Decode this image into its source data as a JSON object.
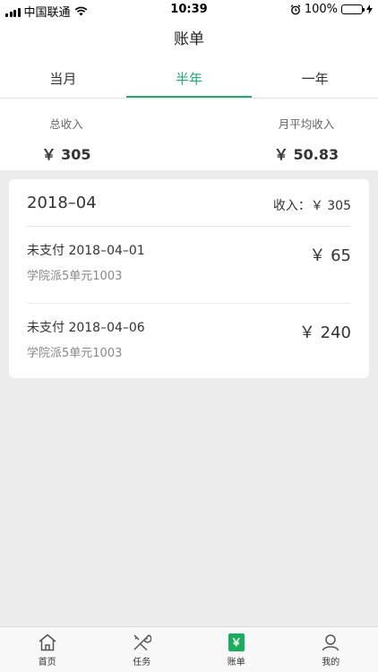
{
  "status_bar": {
    "carrier": "中国联通",
    "time": "10:39",
    "battery": "100%",
    "battery_level": 1.0
  },
  "nav": {
    "title": "账单"
  },
  "tabs": [
    {
      "label": "当月",
      "active": false
    },
    {
      "label": "半年",
      "active": true
    },
    {
      "label": "一年",
      "active": false
    }
  ],
  "summary": {
    "total_label": "总收入",
    "total_value": "￥ 305",
    "avg_label": "月平均收入",
    "avg_value": "￥ 50.83"
  },
  "card": {
    "month": "2018–04",
    "income": "收入：￥ 305",
    "entries": [
      {
        "status_date": "未支付 2018–04–01",
        "address": "学院派5单元1003",
        "amount": "￥ 65"
      },
      {
        "status_date": "未支付 2018–04–06",
        "address": "学院派5单元1003",
        "amount": "￥ 240"
      }
    ]
  },
  "tabbar": {
    "items": [
      {
        "label": "首页",
        "icon": "home-icon"
      },
      {
        "label": "任务",
        "icon": "tools-icon"
      },
      {
        "label": "账单",
        "icon": "yuan-icon",
        "glyph": "￥"
      },
      {
        "label": "我的",
        "icon": "user-icon"
      }
    ]
  },
  "colors": {
    "accent": "#1bab6c",
    "battery": "#1fb24b",
    "background": "#ececec"
  }
}
